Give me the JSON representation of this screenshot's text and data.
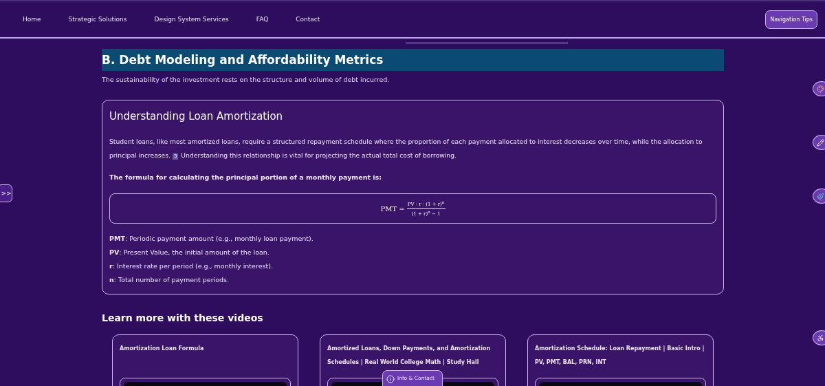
{
  "nav": {
    "links": [
      {
        "label": "Home"
      },
      {
        "label": "Strategic Solutions"
      },
      {
        "label": "Design System Services"
      },
      {
        "label": "FAQ"
      },
      {
        "label": "Contact"
      }
    ],
    "tips_button": "Navigation Tips"
  },
  "side_toggle": ">>",
  "section": {
    "heading": "B. Debt Modeling and Affordability Metrics",
    "subtitle": "The sustainability of the investment rests on the structure and volume of debt incurred."
  },
  "card": {
    "title": "Understanding Loan Amortization",
    "paragraph": {
      "before": "Student loans, like most amortized loans, require a structured repayment schedule where the proportion of each payment allocated to interest decreases over time, while the allocation to principal increases.",
      "footnote": "3",
      "after": "Understanding this relationship is vital for projecting the actual total cost of borrowing."
    },
    "formula_intro": "The formula for calculating the principal portion of a monthly payment is:",
    "formula": {
      "lhs": "PMT =",
      "numerator": "PV · r · (1 + r)$^{n}$",
      "denominator": "(1 + r)$^{n}$ − 1"
    },
    "definitions": [
      {
        "term": "PMT",
        "text": ": Periodic payment amount (e.g., monthly loan payment)."
      },
      {
        "term": "PV",
        "text": ": Present Value, the initial amount of the loan."
      },
      {
        "term": "r",
        "text": ": Interest rate per period (e.g., monthly interest)."
      },
      {
        "term": "n",
        "text": ": Total number of payment periods."
      }
    ]
  },
  "videos": {
    "heading": "Learn more with these videos",
    "items": [
      {
        "title": "Amortization Loan Formula"
      },
      {
        "title": "Amortized Loans, Down Payments, and Amortization Schedules | Real World College Math | Study Hall"
      },
      {
        "title": "Amortization Schedule: Loan Repayment | Basic Intro | PV, PMT, BAL, PRN, INT"
      }
    ]
  },
  "side_tools": [
    {
      "kind": "palette"
    },
    {
      "kind": "pen"
    },
    {
      "kind": "brush"
    },
    {
      "kind": "accessibility"
    }
  ],
  "info_tab": "Info & Contact"
}
